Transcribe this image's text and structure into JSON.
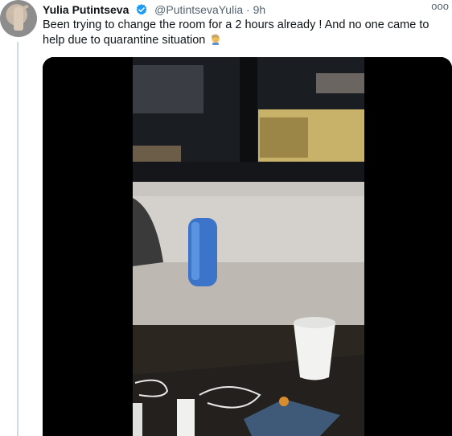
{
  "tweet": {
    "author_name": "Yulia Putintseva",
    "author_handle": "@PutintsevaYulia",
    "separator": "·",
    "timestamp": "9h",
    "more_label": "ooo",
    "text": "Been trying to change the room for a 2 hours already ! And no one came to help due to quarantine situation",
    "emoji": "facepalm-emoji",
    "media": {
      "type": "video"
    }
  },
  "colors": {
    "verified_badge": "#1d9bf0",
    "handle_text": "#536471",
    "thread_line": "#cfd9de",
    "media_background": "#000000"
  }
}
